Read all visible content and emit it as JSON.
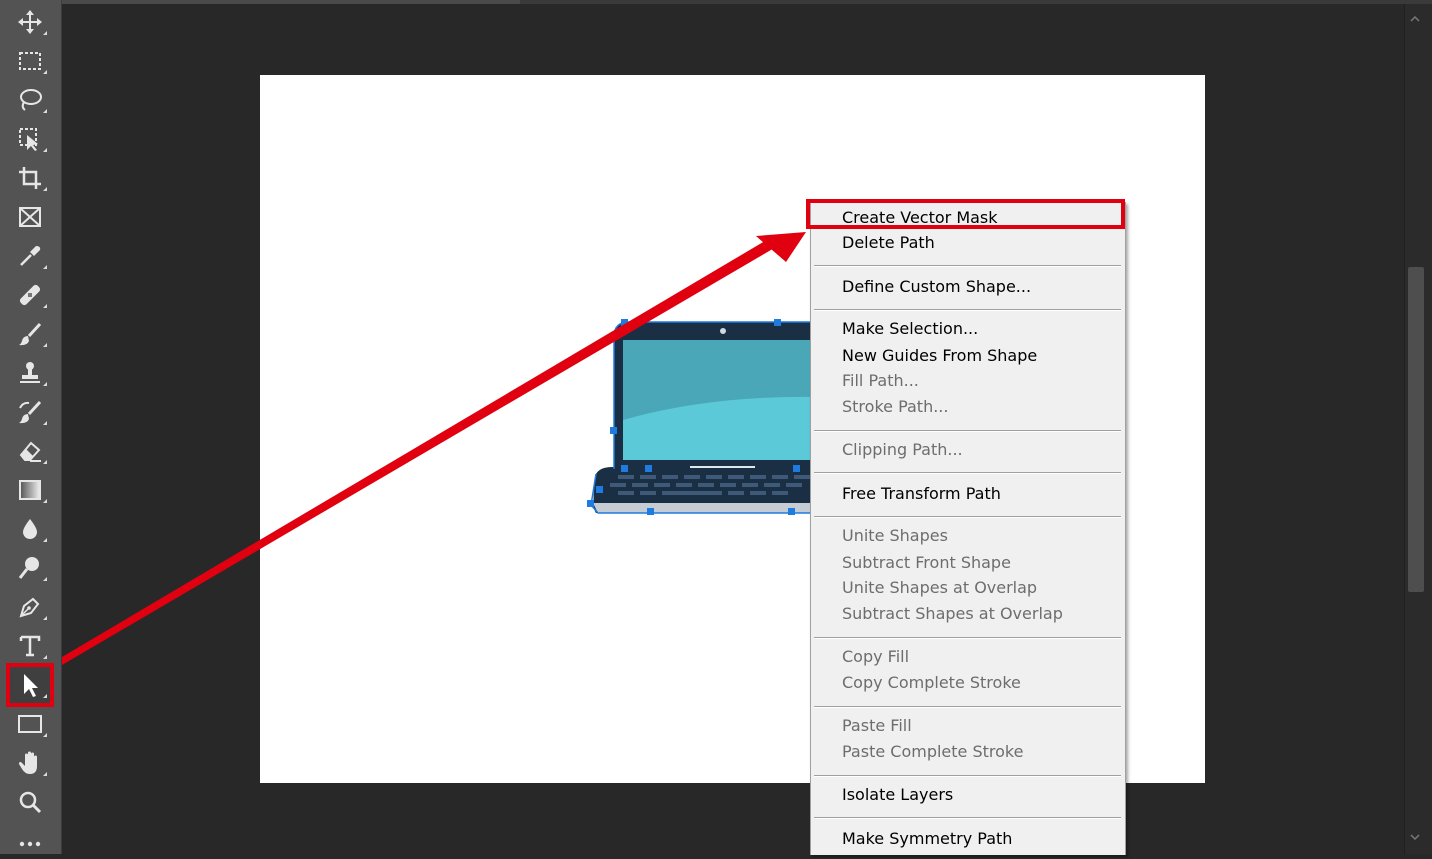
{
  "app": {
    "accent_color": "#e1000f",
    "selection_color": "#1e7be0"
  },
  "toolbar": {
    "tools": [
      {
        "name": "move-icon",
        "label": "Move Tool"
      },
      {
        "name": "marquee-icon",
        "label": "Rectangular Marquee Tool"
      },
      {
        "name": "lasso-icon",
        "label": "Lasso Tool"
      },
      {
        "name": "object-selection-icon",
        "label": "Object Selection Tool"
      },
      {
        "name": "crop-icon",
        "label": "Crop Tool"
      },
      {
        "name": "frame-icon",
        "label": "Frame Tool"
      },
      {
        "name": "eyedropper-icon",
        "label": "Eyedropper Tool"
      },
      {
        "name": "healing-brush-icon",
        "label": "Spot Healing Brush Tool"
      },
      {
        "name": "brush-icon",
        "label": "Brush Tool"
      },
      {
        "name": "clone-stamp-icon",
        "label": "Clone Stamp Tool"
      },
      {
        "name": "history-brush-icon",
        "label": "History Brush Tool"
      },
      {
        "name": "eraser-icon",
        "label": "Eraser Tool"
      },
      {
        "name": "gradient-icon",
        "label": "Gradient Tool"
      },
      {
        "name": "blur-icon",
        "label": "Blur Tool"
      },
      {
        "name": "dodge-icon",
        "label": "Dodge Tool"
      },
      {
        "name": "pen-icon",
        "label": "Pen Tool"
      },
      {
        "name": "type-icon",
        "label": "Type Tool"
      },
      {
        "name": "path-selection-icon",
        "label": "Path Selection Tool",
        "active": true
      },
      {
        "name": "rectangle-icon",
        "label": "Rectangle Tool"
      },
      {
        "name": "hand-icon",
        "label": "Hand Tool"
      },
      {
        "name": "zoom-icon",
        "label": "Zoom Tool"
      },
      {
        "name": "more-tools-icon",
        "label": "Edit Toolbar"
      }
    ]
  },
  "context_menu": {
    "items": {
      "create_vector_mask": "Create Vector Mask",
      "delete_path": "Delete Path",
      "define_custom_shape": "Define Custom Shape...",
      "make_selection": "Make Selection...",
      "new_guides_from_shape": "New Guides From Shape",
      "fill_path": "Fill Path...",
      "stroke_path": "Stroke Path...",
      "clipping_path": "Clipping Path...",
      "free_transform_path": "Free Transform Path",
      "unite_shapes": "Unite Shapes",
      "subtract_front_shape": "Subtract Front Shape",
      "unite_shapes_at_overlap": "Unite Shapes at Overlap",
      "subtract_shapes_at_overlap": "Subtract Shapes at Overlap",
      "copy_fill": "Copy Fill",
      "copy_complete_stroke": "Copy Complete Stroke",
      "paste_fill": "Paste Fill",
      "paste_complete_stroke": "Paste Complete Stroke",
      "isolate_layers": "Isolate Layers",
      "make_symmetry_path": "Make Symmetry Path"
    }
  }
}
